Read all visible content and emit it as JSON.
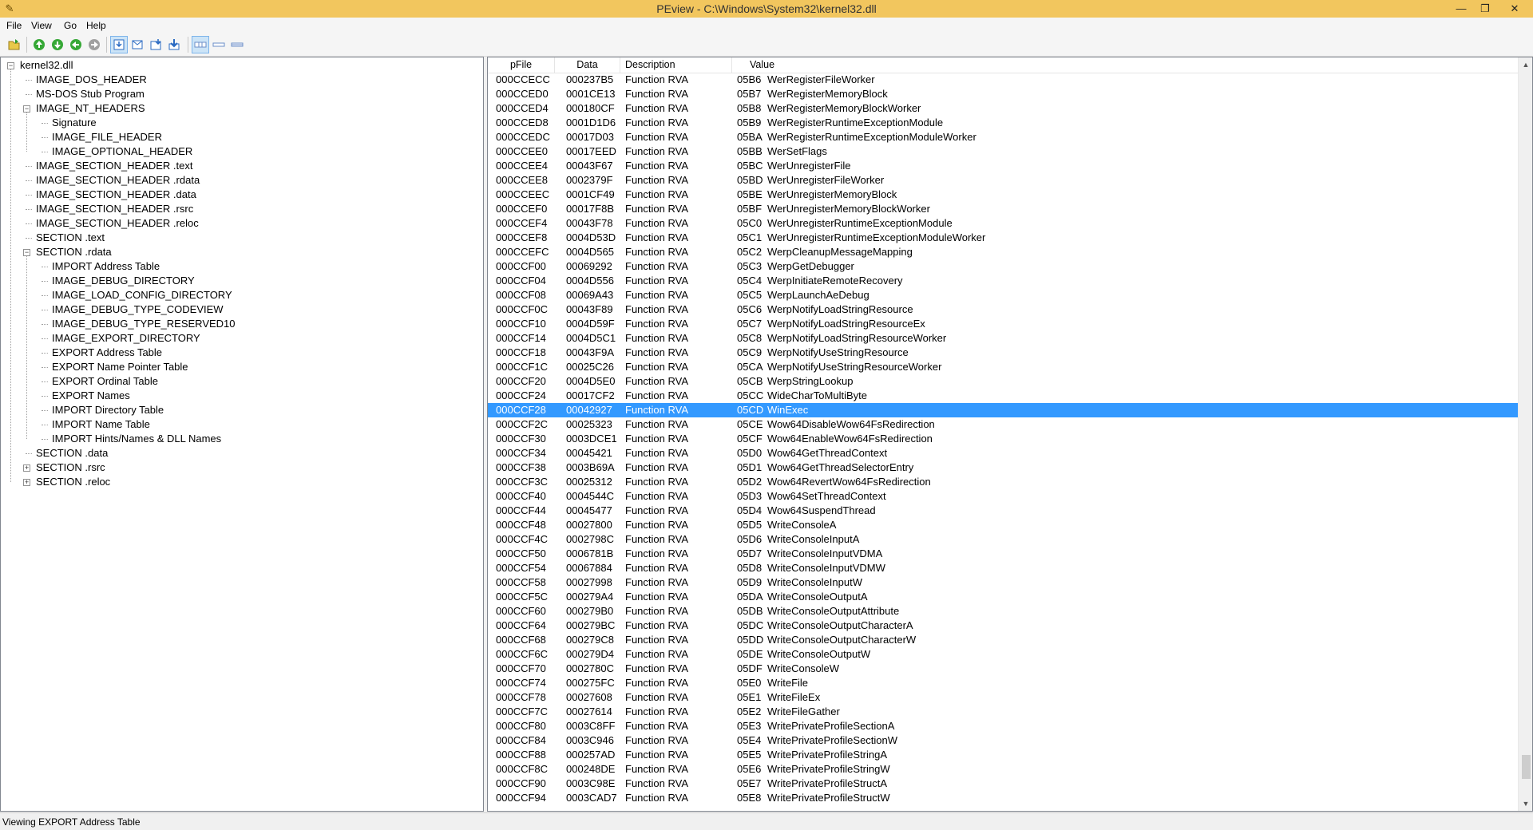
{
  "window": {
    "title": "PEview - C:\\Windows\\System32\\kernel32.dll",
    "minimize": "—",
    "maximize": "❐",
    "close": "✕"
  },
  "menu": [
    "File",
    "View",
    "Go",
    "Help"
  ],
  "tree": [
    {
      "label": "kernel32.dll",
      "level": 0,
      "expander": "minus"
    },
    {
      "label": "IMAGE_DOS_HEADER",
      "level": 1
    },
    {
      "label": "MS-DOS Stub Program",
      "level": 1
    },
    {
      "label": "IMAGE_NT_HEADERS",
      "level": 1,
      "expander": "minus"
    },
    {
      "label": "Signature",
      "level": 2
    },
    {
      "label": "IMAGE_FILE_HEADER",
      "level": 2
    },
    {
      "label": "IMAGE_OPTIONAL_HEADER",
      "level": 2
    },
    {
      "label": "IMAGE_SECTION_HEADER .text",
      "level": 1
    },
    {
      "label": "IMAGE_SECTION_HEADER .rdata",
      "level": 1
    },
    {
      "label": "IMAGE_SECTION_HEADER .data",
      "level": 1
    },
    {
      "label": "IMAGE_SECTION_HEADER .rsrc",
      "level": 1
    },
    {
      "label": "IMAGE_SECTION_HEADER .reloc",
      "level": 1
    },
    {
      "label": "SECTION .text",
      "level": 1
    },
    {
      "label": "SECTION .rdata",
      "level": 1,
      "expander": "minus"
    },
    {
      "label": "IMPORT Address Table",
      "level": 2
    },
    {
      "label": "IMAGE_DEBUG_DIRECTORY",
      "level": 2
    },
    {
      "label": "IMAGE_LOAD_CONFIG_DIRECTORY",
      "level": 2
    },
    {
      "label": "IMAGE_DEBUG_TYPE_CODEVIEW",
      "level": 2
    },
    {
      "label": "IMAGE_DEBUG_TYPE_RESERVED10",
      "level": 2
    },
    {
      "label": "IMAGE_EXPORT_DIRECTORY",
      "level": 2
    },
    {
      "label": "EXPORT Address Table",
      "level": 2
    },
    {
      "label": "EXPORT Name Pointer Table",
      "level": 2
    },
    {
      "label": "EXPORT Ordinal Table",
      "level": 2
    },
    {
      "label": "EXPORT Names",
      "level": 2
    },
    {
      "label": "IMPORT Directory Table",
      "level": 2
    },
    {
      "label": "IMPORT Name Table",
      "level": 2
    },
    {
      "label": "IMPORT Hints/Names & DLL Names",
      "level": 2
    },
    {
      "label": "SECTION .data",
      "level": 1
    },
    {
      "label": "SECTION .rsrc",
      "level": 1,
      "expander": "plus"
    },
    {
      "label": "SECTION .reloc",
      "level": 1,
      "expander": "plus"
    }
  ],
  "columns": [
    "pFile",
    "Data",
    "Description",
    "Value"
  ],
  "selected_row": 24,
  "rows": [
    [
      "000CCECC",
      "000237B5",
      "Function RVA",
      "05B6",
      "WerRegisterFileWorker"
    ],
    [
      "000CCED0",
      "0001CE13",
      "Function RVA",
      "05B7",
      "WerRegisterMemoryBlock"
    ],
    [
      "000CCED4",
      "000180CF",
      "Function RVA",
      "05B8",
      "WerRegisterMemoryBlockWorker"
    ],
    [
      "000CCED8",
      "0001D1D6",
      "Function RVA",
      "05B9",
      "WerRegisterRuntimeExceptionModule"
    ],
    [
      "000CCEDC",
      "00017D03",
      "Function RVA",
      "05BA",
      "WerRegisterRuntimeExceptionModuleWorker"
    ],
    [
      "000CCEE0",
      "00017EED",
      "Function RVA",
      "05BB",
      "WerSetFlags"
    ],
    [
      "000CCEE4",
      "00043F67",
      "Function RVA",
      "05BC",
      "WerUnregisterFile"
    ],
    [
      "000CCEE8",
      "0002379F",
      "Function RVA",
      "05BD",
      "WerUnregisterFileWorker"
    ],
    [
      "000CCEEC",
      "0001CF49",
      "Function RVA",
      "05BE",
      "WerUnregisterMemoryBlock"
    ],
    [
      "000CCEF0",
      "00017F8B",
      "Function RVA",
      "05BF",
      "WerUnregisterMemoryBlockWorker"
    ],
    [
      "000CCEF4",
      "00043F78",
      "Function RVA",
      "05C0",
      "WerUnregisterRuntimeExceptionModule"
    ],
    [
      "000CCEF8",
      "0004D53D",
      "Function RVA",
      "05C1",
      "WerUnregisterRuntimeExceptionModuleWorker"
    ],
    [
      "000CCEFC",
      "0004D565",
      "Function RVA",
      "05C2",
      "WerpCleanupMessageMapping"
    ],
    [
      "000CCF00",
      "00069292",
      "Function RVA",
      "05C3",
      "WerpGetDebugger"
    ],
    [
      "000CCF04",
      "0004D556",
      "Function RVA",
      "05C4",
      "WerpInitiateRemoteRecovery"
    ],
    [
      "000CCF08",
      "00069A43",
      "Function RVA",
      "05C5",
      "WerpLaunchAeDebug"
    ],
    [
      "000CCF0C",
      "00043F89",
      "Function RVA",
      "05C6",
      "WerpNotifyLoadStringResource"
    ],
    [
      "000CCF10",
      "0004D59F",
      "Function RVA",
      "05C7",
      "WerpNotifyLoadStringResourceEx"
    ],
    [
      "000CCF14",
      "0004D5C1",
      "Function RVA",
      "05C8",
      "WerpNotifyLoadStringResourceWorker"
    ],
    [
      "000CCF18",
      "00043F9A",
      "Function RVA",
      "05C9",
      "WerpNotifyUseStringResource"
    ],
    [
      "000CCF1C",
      "00025C26",
      "Function RVA",
      "05CA",
      "WerpNotifyUseStringResourceWorker"
    ],
    [
      "000CCF20",
      "0004D5E0",
      "Function RVA",
      "05CB",
      "WerpStringLookup"
    ],
    [
      "000CCF24",
      "00017CF2",
      "Function RVA",
      "05CC",
      "WideCharToMultiByte"
    ],
    [
      "000CCF28",
      "00042927",
      "Function RVA",
      "05CD",
      "WinExec"
    ],
    [
      "000CCF2C",
      "00025323",
      "Function RVA",
      "05CE",
      "Wow64DisableWow64FsRedirection"
    ],
    [
      "000CCF30",
      "0003DCE1",
      "Function RVA",
      "05CF",
      "Wow64EnableWow64FsRedirection"
    ],
    [
      "000CCF34",
      "00045421",
      "Function RVA",
      "05D0",
      "Wow64GetThreadContext"
    ],
    [
      "000CCF38",
      "0003B69A",
      "Function RVA",
      "05D1",
      "Wow64GetThreadSelectorEntry"
    ],
    [
      "000CCF3C",
      "00025312",
      "Function RVA",
      "05D2",
      "Wow64RevertWow64FsRedirection"
    ],
    [
      "000CCF40",
      "0004544C",
      "Function RVA",
      "05D3",
      "Wow64SetThreadContext"
    ],
    [
      "000CCF44",
      "00045477",
      "Function RVA",
      "05D4",
      "Wow64SuspendThread"
    ],
    [
      "000CCF48",
      "00027800",
      "Function RVA",
      "05D5",
      "WriteConsoleA"
    ],
    [
      "000CCF4C",
      "0002798C",
      "Function RVA",
      "05D6",
      "WriteConsoleInputA"
    ],
    [
      "000CCF50",
      "0006781B",
      "Function RVA",
      "05D7",
      "WriteConsoleInputVDMA"
    ],
    [
      "000CCF54",
      "00067884",
      "Function RVA",
      "05D8",
      "WriteConsoleInputVDMW"
    ],
    [
      "000CCF58",
      "00027998",
      "Function RVA",
      "05D9",
      "WriteConsoleInputW"
    ],
    [
      "000CCF5C",
      "000279A4",
      "Function RVA",
      "05DA",
      "WriteConsoleOutputA"
    ],
    [
      "000CCF60",
      "000279B0",
      "Function RVA",
      "05DB",
      "WriteConsoleOutputAttribute"
    ],
    [
      "000CCF64",
      "000279BC",
      "Function RVA",
      "05DC",
      "WriteConsoleOutputCharacterA"
    ],
    [
      "000CCF68",
      "000279C8",
      "Function RVA",
      "05DD",
      "WriteConsoleOutputCharacterW"
    ],
    [
      "000CCF6C",
      "000279D4",
      "Function RVA",
      "05DE",
      "WriteConsoleOutputW"
    ],
    [
      "000CCF70",
      "0002780C",
      "Function RVA",
      "05DF",
      "WriteConsoleW"
    ],
    [
      "000CCF74",
      "000275FC",
      "Function RVA",
      "05E0",
      "WriteFile"
    ],
    [
      "000CCF78",
      "00027608",
      "Function RVA",
      "05E1",
      "WriteFileEx"
    ],
    [
      "000CCF7C",
      "00027614",
      "Function RVA",
      "05E2",
      "WriteFileGather"
    ],
    [
      "000CCF80",
      "0003C8FF",
      "Function RVA",
      "05E3",
      "WritePrivateProfileSectionA"
    ],
    [
      "000CCF84",
      "0003C946",
      "Function RVA",
      "05E4",
      "WritePrivateProfileSectionW"
    ],
    [
      "000CCF88",
      "000257AD",
      "Function RVA",
      "05E5",
      "WritePrivateProfileStringA"
    ],
    [
      "000CCF8C",
      "000248DE",
      "Function RVA",
      "05E6",
      "WritePrivateProfileStringW"
    ],
    [
      "000CCF90",
      "0003C98E",
      "Function RVA",
      "05E7",
      "WritePrivateProfileStructA"
    ],
    [
      "000CCF94",
      "0003CAD7",
      "Function RVA",
      "05E8",
      "WritePrivateProfileStructW"
    ]
  ],
  "status": "Viewing EXPORT Address Table"
}
